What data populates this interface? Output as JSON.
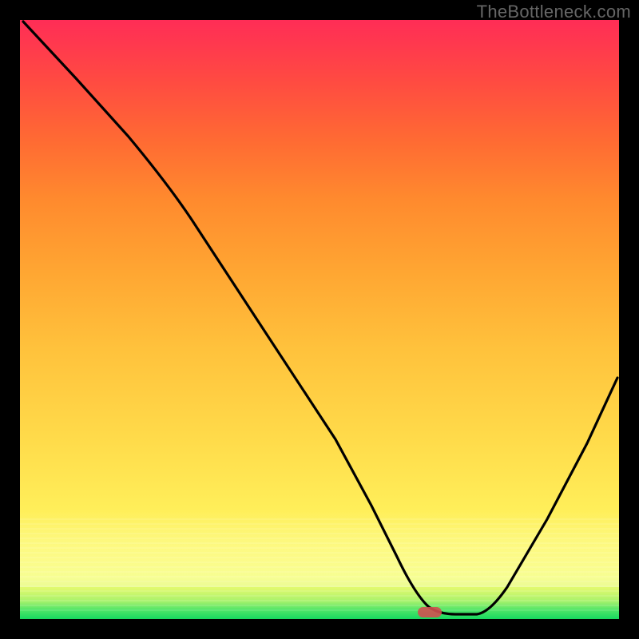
{
  "watermark": "TheBottleneck.com",
  "colors": {
    "frame_bg": "#000000",
    "curve_stroke": "#000000",
    "marker_fill": "#d05050",
    "gradient_top": "#ff2d56",
    "gradient_bottom": "#17d860"
  },
  "chart_data": {
    "type": "line",
    "title": "",
    "xlabel": "",
    "ylabel": "",
    "xlim": [
      0,
      100
    ],
    "ylim": [
      0,
      100
    ],
    "grid": false,
    "legend": false,
    "background": "vertical-gradient green→yellow→orange→red (bottleneck heat)",
    "series": [
      {
        "name": "bottleneck-curve",
        "x": [
          0,
          8,
          16,
          23,
          28,
          35,
          42,
          50,
          56,
          60,
          63,
          66,
          69,
          72,
          76,
          82,
          88,
          94,
          100
        ],
        "y": [
          100,
          91,
          82,
          74,
          68,
          58,
          47,
          35,
          25,
          17,
          10,
          5,
          2,
          1,
          1,
          7,
          18,
          31,
          45
        ]
      }
    ],
    "annotations": [
      {
        "name": "optimal-marker",
        "shape": "rounded-rect",
        "x": 69,
        "y": 0.5,
        "color": "#d05050"
      }
    ],
    "notes": "V-shaped curve whose minimum (near x≈69) indicates the balanced / no-bottleneck point; background color encodes severity (green=good at bottom, red=bad at top). Values estimated from pixels."
  }
}
